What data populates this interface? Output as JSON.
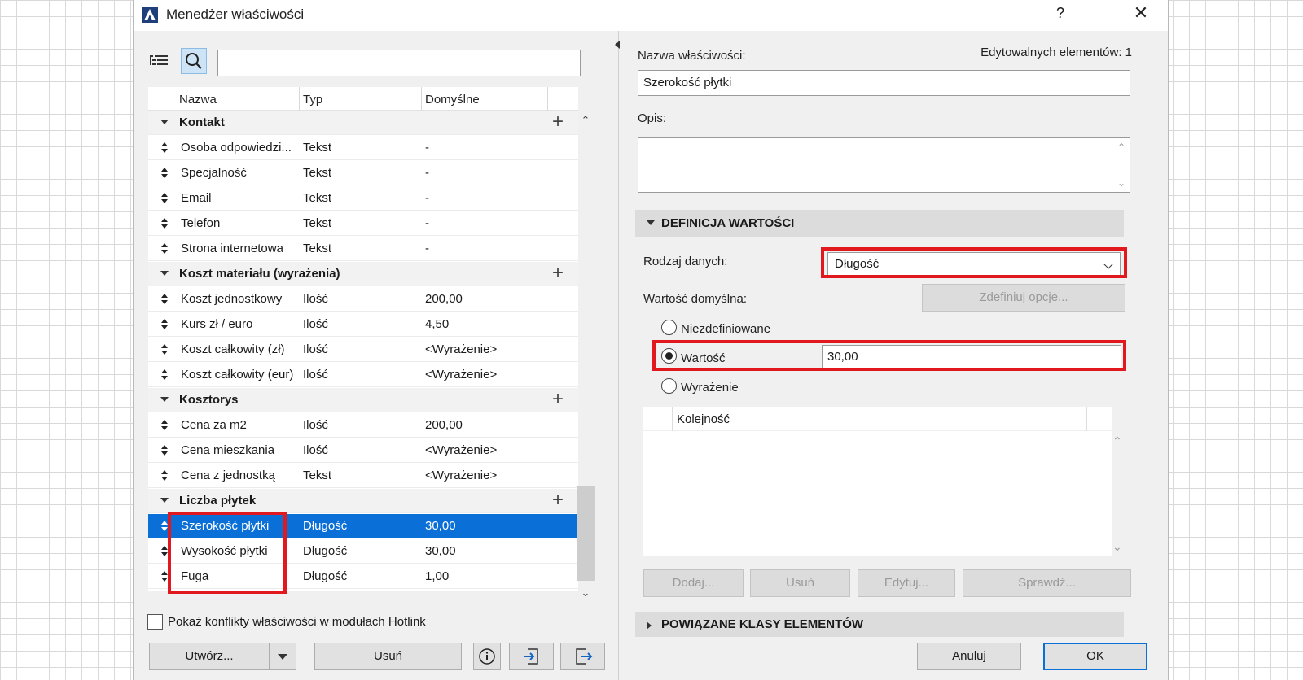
{
  "window": {
    "title": "Menedżer właściwości",
    "help": "?",
    "close": "✕"
  },
  "left": {
    "columns": {
      "name": "Nazwa",
      "type": "Typ",
      "default": "Domyślne"
    },
    "rows": [
      {
        "kind": "group",
        "name": "Kontakt"
      },
      {
        "kind": "item",
        "name": "Osoba odpowiedzi...",
        "type": "Tekst",
        "default": "-"
      },
      {
        "kind": "item",
        "name": "Specjalność",
        "type": "Tekst",
        "default": "-"
      },
      {
        "kind": "item",
        "name": "Email",
        "type": "Tekst",
        "default": "-"
      },
      {
        "kind": "item",
        "name": "Telefon",
        "type": "Tekst",
        "default": "-"
      },
      {
        "kind": "item",
        "name": "Strona internetowa",
        "type": "Tekst",
        "default": "-"
      },
      {
        "kind": "group",
        "name": "Koszt materiału (wyrażenia)"
      },
      {
        "kind": "item",
        "name": "Koszt jednostkowy",
        "type": "Ilość",
        "default": "200,00"
      },
      {
        "kind": "item",
        "name": "Kurs zł / euro",
        "type": "Ilość",
        "default": "4,50"
      },
      {
        "kind": "item",
        "name": "Koszt całkowity (zł)",
        "type": "Ilość",
        "default": "<Wyrażenie>"
      },
      {
        "kind": "item",
        "name": "Koszt całkowity (eur)",
        "type": "Ilość",
        "default": "<Wyrażenie>"
      },
      {
        "kind": "group",
        "name": "Kosztorys"
      },
      {
        "kind": "item",
        "name": "Cena za m2",
        "type": "Ilość",
        "default": "200,00"
      },
      {
        "kind": "item",
        "name": "Cena mieszkania",
        "type": "Ilość",
        "default": "<Wyrażenie>"
      },
      {
        "kind": "item",
        "name": "Cena z jednostką",
        "type": "Tekst",
        "default": "<Wyrażenie>"
      },
      {
        "kind": "group",
        "name": "Liczba płytek"
      },
      {
        "kind": "item",
        "name": "Szerokość płytki",
        "type": "Długość",
        "default": "30,00",
        "selected": true
      },
      {
        "kind": "item",
        "name": "Wysokość płytki",
        "type": "Długość",
        "default": "30,00"
      },
      {
        "kind": "item",
        "name": "Fuga",
        "type": "Długość",
        "default": "1,00"
      }
    ],
    "hotlink_checkbox": "Pokaż konflikty właściwości w modułach Hotlink",
    "create_button": "Utwórz...",
    "delete_button": "Usuń"
  },
  "right": {
    "name_label": "Nazwa właściwości:",
    "editable_label": "Edytowalnych elementów: 1",
    "name_value": "Szerokość płytki",
    "desc_label": "Opis:",
    "value_def_header": "DEFINICJA WARTOŚCI",
    "data_type_label": "Rodzaj danych:",
    "data_type_value": "Długość",
    "default_value_label": "Wartość domyślna:",
    "define_options_button": "Zdefiniuj opcje...",
    "radio_undefined": "Niezdefiniowane",
    "radio_value": "Wartość",
    "value_input": "30,00",
    "radio_expression": "Wyrażenie",
    "order_header": "Kolejność",
    "add_button": "Dodaj...",
    "remove_button": "Usuń",
    "edit_button": "Edytuj...",
    "check_button": "Sprawdź...",
    "related_classes_header": "POWIĄZANE KLASY ELEMENTÓW",
    "cancel_button": "Anuluj",
    "ok_button": "OK"
  }
}
